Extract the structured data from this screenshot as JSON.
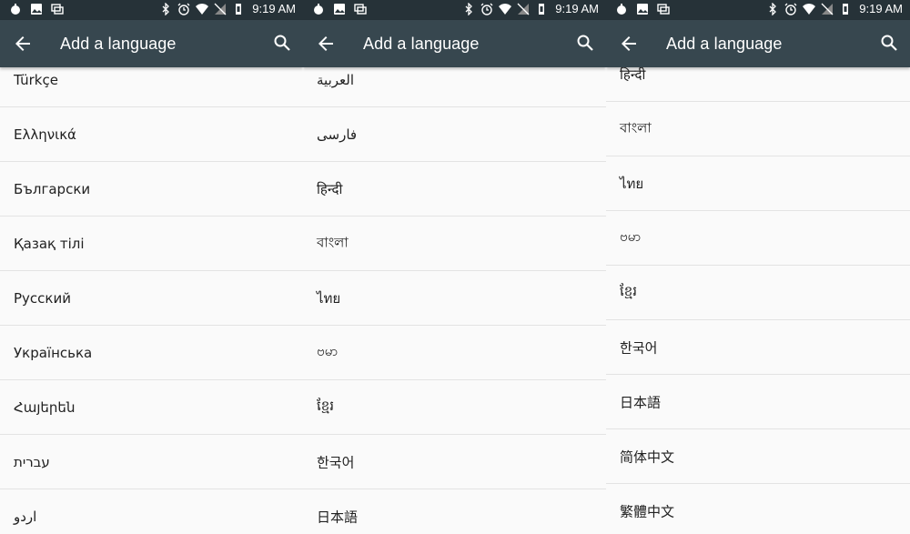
{
  "status": {
    "time": "9:19 AM"
  },
  "toolbar": {
    "title": "Add a language",
    "back_icon": "arrow-back-icon",
    "search_icon": "search-icon"
  },
  "panels": [
    {
      "languages": [
        "Türkçe",
        "Ελληνικά",
        "Български",
        "Қазақ тілі",
        "Русский",
        "Українська",
        "Հայերեն",
        "עברית",
        "اردو"
      ]
    },
    {
      "languages": [
        "العربية",
        "فارسی",
        "हिन्दी",
        "বাংলা",
        "ไทย",
        "ဗမာ",
        "ខ្មែរ",
        "한국어",
        "日本語"
      ]
    },
    {
      "languages": [
        "हिन्दी",
        "বাংলা",
        "ไทย",
        "ဗမာ",
        "ខ្មែរ",
        "한국어",
        "日本語",
        "简体中文",
        "繁體中文"
      ]
    }
  ],
  "colors": {
    "statusbar": "#263238",
    "toolbar": "#37474f",
    "background": "#fafafa",
    "divider": "#e3e3e3"
  }
}
